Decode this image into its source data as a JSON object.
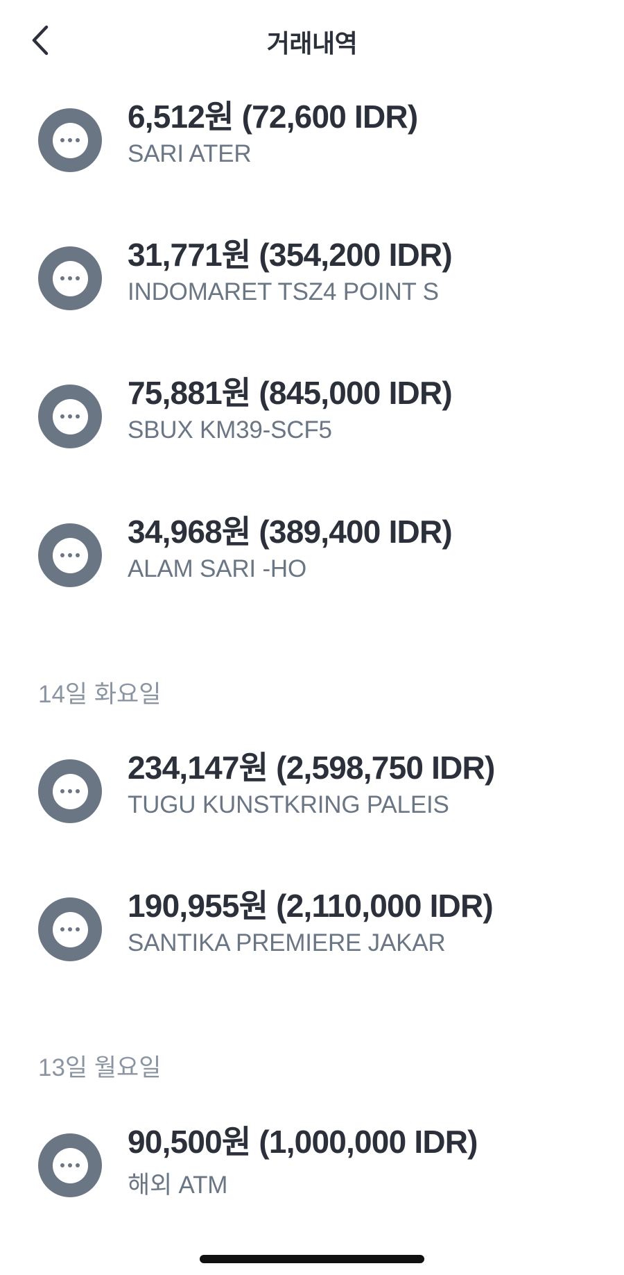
{
  "header": {
    "title": "거래내역"
  },
  "groups": [
    {
      "date_label": "",
      "transactions": [
        {
          "amount": "6,512원 (72,600 IDR)",
          "merchant": "SARI ATER"
        },
        {
          "amount": "31,771원 (354,200 IDR)",
          "merchant": "INDOMARET TSZ4 POINT S"
        },
        {
          "amount": "75,881원 (845,000 IDR)",
          "merchant": "SBUX KM39-SCF5"
        },
        {
          "amount": "34,968원 (389,400 IDR)",
          "merchant": "ALAM SARI -HO"
        }
      ]
    },
    {
      "date_label": "14일 화요일",
      "transactions": [
        {
          "amount": "234,147원 (2,598,750 IDR)",
          "merchant": "TUGU KUNSTKRING PALEIS"
        },
        {
          "amount": "190,955원 (2,110,000 IDR)",
          "merchant": "SANTIKA PREMIERE JAKAR"
        }
      ]
    },
    {
      "date_label": "13일 월요일",
      "transactions": [
        {
          "amount": "90,500원 (1,000,000 IDR)",
          "merchant": "해외 ATM"
        }
      ]
    }
  ],
  "colors": {
    "icon_gray": "#6b7685",
    "text_primary": "#2b303a",
    "text_secondary": "#6b7685",
    "date_header": "#8b95a1"
  }
}
